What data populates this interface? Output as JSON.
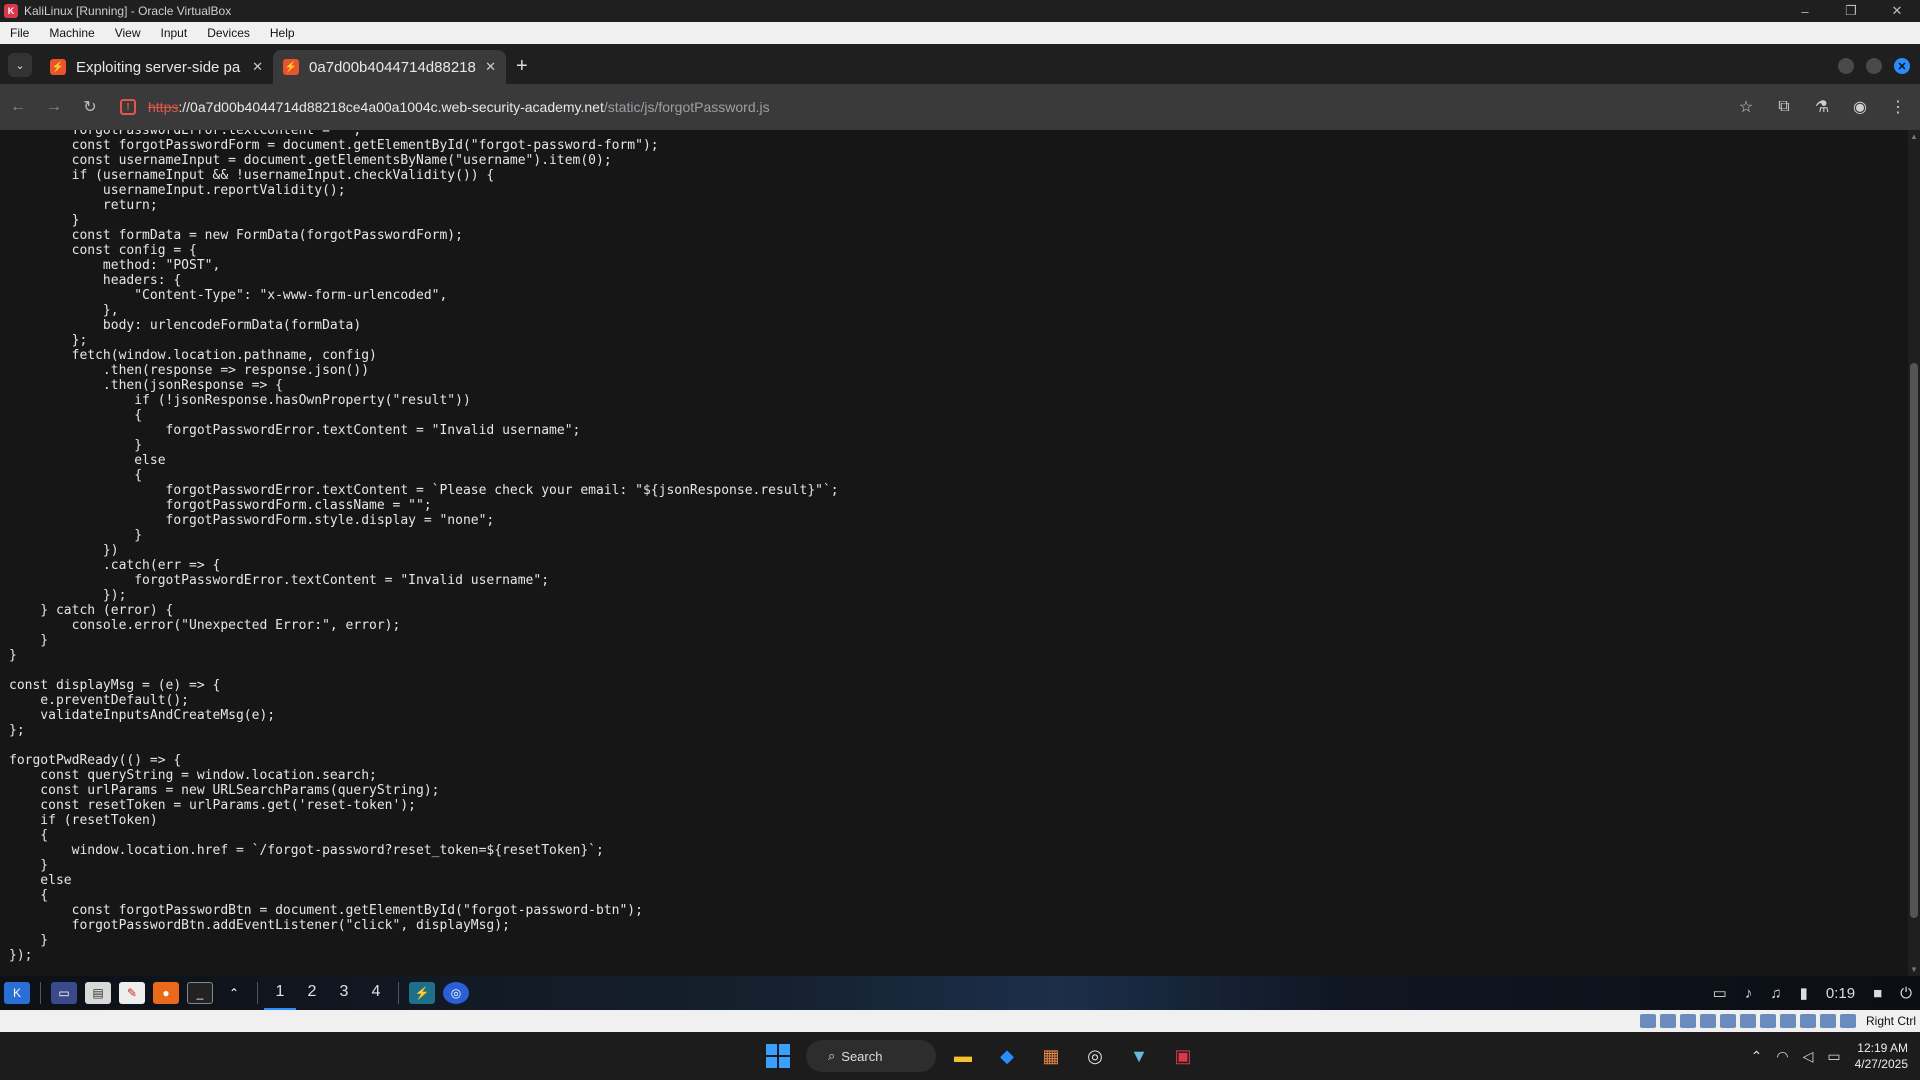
{
  "host_window": {
    "title": "KaliLinux [Running] - Oracle VirtualBox",
    "menu": [
      "File",
      "Machine",
      "View",
      "Input",
      "Devices",
      "Help"
    ],
    "controls": [
      "–",
      "❐",
      "✕"
    ]
  },
  "browser": {
    "tabs": [
      {
        "label": "Exploiting server-side pa",
        "active": false
      },
      {
        "label": "0a7d00b4044714d88218",
        "active": true
      }
    ],
    "new_tab": "+",
    "url": {
      "scheme": "https",
      "rest_host": "://0a7d00b4044714d88218ce4a00a1004c.web-security-academy.net",
      "path": "/static/js/forgotPassword.js"
    },
    "code_lines": [
      "        forgotPasswordError.textContent = \"\";",
      "        const forgotPasswordForm = document.getElementById(\"forgot-password-form\");",
      "        const usernameInput = document.getElementsByName(\"username\").item(0);",
      "        if (usernameInput && !usernameInput.checkValidity()) {",
      "            usernameInput.reportValidity();",
      "            return;",
      "        }",
      "        const formData = new FormData(forgotPasswordForm);",
      "        const config = {",
      "            method: \"POST\",",
      "            headers: {",
      "                \"Content-Type\": \"x-www-form-urlencoded\",",
      "            },",
      "            body: urlencodeFormData(formData)",
      "        };",
      "        fetch(window.location.pathname, config)",
      "            .then(response => response.json())",
      "            .then(jsonResponse => {",
      "                if (!jsonResponse.hasOwnProperty(\"result\"))",
      "                {",
      "                    forgotPasswordError.textContent = \"Invalid username\";",
      "                }",
      "                else",
      "                {",
      "                    forgotPasswordError.textContent = `Please check your email: \"${jsonResponse.result}\"`;",
      "                    forgotPasswordForm.className = \"\";",
      "                    forgotPasswordForm.style.display = \"none\";",
      "                }",
      "            })",
      "            .catch(err => {",
      "                forgotPasswordError.textContent = \"Invalid username\";",
      "            });",
      "    } catch (error) {",
      "        console.error(\"Unexpected Error:\", error);",
      "    }",
      "}",
      "",
      "const displayMsg = (e) => {",
      "    e.preventDefault();",
      "    validateInputsAndCreateMsg(e);",
      "};",
      "",
      "forgotPwdReady(() => {",
      "    const queryString = window.location.search;",
      "    const urlParams = new URLSearchParams(queryString);",
      "    const resetToken = urlParams.get('reset-token');",
      "    if (resetToken)",
      "    {",
      "        window.location.href = `/forgot-password?reset_token=${resetToken}`;",
      "    }",
      "    else",
      "    {",
      "        const forgotPasswordBtn = document.getElementById(\"forgot-password-btn\");",
      "        forgotPasswordBtn.addEventListener(\"click\", displayMsg);",
      "    }",
      "});"
    ]
  },
  "kali_panel": {
    "workspaces": [
      "1",
      "2",
      "3",
      "4"
    ],
    "clock": "0:19"
  },
  "vb_status": {
    "host_key": "Right Ctrl"
  },
  "win_taskbar": {
    "search_label": "Search",
    "time": "12:19 AM",
    "date": "4/27/2025"
  }
}
